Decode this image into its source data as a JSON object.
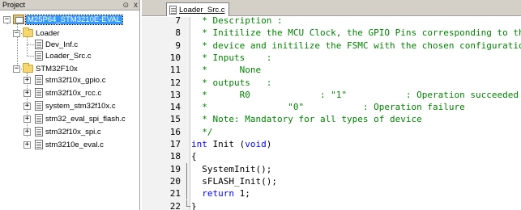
{
  "project_pane": {
    "title": "Project",
    "pin_icon": "pin-icon",
    "close_label": "x",
    "tree": {
      "target": {
        "label": "M25P64_STM3210E-EVAL",
        "expand_glyph": "−"
      },
      "groups": [
        {
          "label": "Loader",
          "expand_glyph": "−",
          "files": [
            "Dev_Inf.c",
            "Loader_Src.c"
          ]
        },
        {
          "label": "STM32F10x",
          "expand_glyph": "−",
          "files": [
            "stm32f10x_gpio.c",
            "stm32f10x_rcc.c",
            "system_stm32f10x.c",
            "stm32_eval_spi_flash.c",
            "stm32f10x_spi.c",
            "stm3210e_eval.c"
          ],
          "file_expand_glyph": "+"
        }
      ]
    }
  },
  "editor": {
    "tab_label": "Loader_Src.c",
    "lines": [
      {
        "num": "7",
        "segments": [
          {
            "t": "  * Description :",
            "c": "cmt"
          }
        ]
      },
      {
        "num": "8",
        "segments": [
          {
            "t": "  * Initilize the MCU Clock, the GPIO Pins corresponding to the",
            "c": "cmt"
          }
        ]
      },
      {
        "num": "9",
        "segments": [
          {
            "t": "  * device and initilize the FSMC with the chosen configuration",
            "c": "cmt"
          }
        ]
      },
      {
        "num": "10",
        "segments": [
          {
            "t": "  * Inputs    :",
            "c": "cmt"
          }
        ]
      },
      {
        "num": "11",
        "segments": [
          {
            "t": "  *      None",
            "c": "cmt"
          }
        ]
      },
      {
        "num": "12",
        "segments": [
          {
            "t": "  * outputs   :",
            "c": "cmt"
          }
        ]
      },
      {
        "num": "13",
        "segments": [
          {
            "t": "  *      R0             : \"1\"           : Operation succeeded",
            "c": "cmt"
          }
        ]
      },
      {
        "num": "14",
        "segments": [
          {
            "t": "  *               \"0\"           : Operation failure",
            "c": "cmt"
          }
        ]
      },
      {
        "num": "15",
        "segments": [
          {
            "t": "  * Note: Mandatory for all types of device",
            "c": "cmt"
          }
        ]
      },
      {
        "num": "16",
        "segments": [
          {
            "t": "  */",
            "c": "cmt"
          }
        ]
      },
      {
        "num": "17",
        "segments": [
          {
            "t": "int",
            "c": "kw"
          },
          {
            "t": " Init (",
            "c": ""
          },
          {
            "t": "void",
            "c": "kw"
          },
          {
            "t": ")",
            "c": ""
          }
        ]
      },
      {
        "num": "18",
        "segments": [
          {
            "t": "{",
            "c": ""
          }
        ],
        "fold": "open",
        "fold_glyph": "−"
      },
      {
        "num": "19",
        "segments": [
          {
            "t": "  SystemInit();",
            "c": ""
          }
        ]
      },
      {
        "num": "20",
        "segments": [
          {
            "t": "  sFLASH_Init();",
            "c": ""
          }
        ]
      },
      {
        "num": "21",
        "segments": [
          {
            "t": "  ",
            "c": ""
          },
          {
            "t": "return",
            "c": "kw"
          },
          {
            "t": " 1;",
            "c": ""
          }
        ]
      },
      {
        "num": "22",
        "segments": [
          {
            "t": "}",
            "c": ""
          }
        ]
      }
    ]
  },
  "colors": {
    "comment": "#008000",
    "keyword": "#0000ff",
    "selection": "#3399ff",
    "chrome": "#d4d0c8"
  }
}
